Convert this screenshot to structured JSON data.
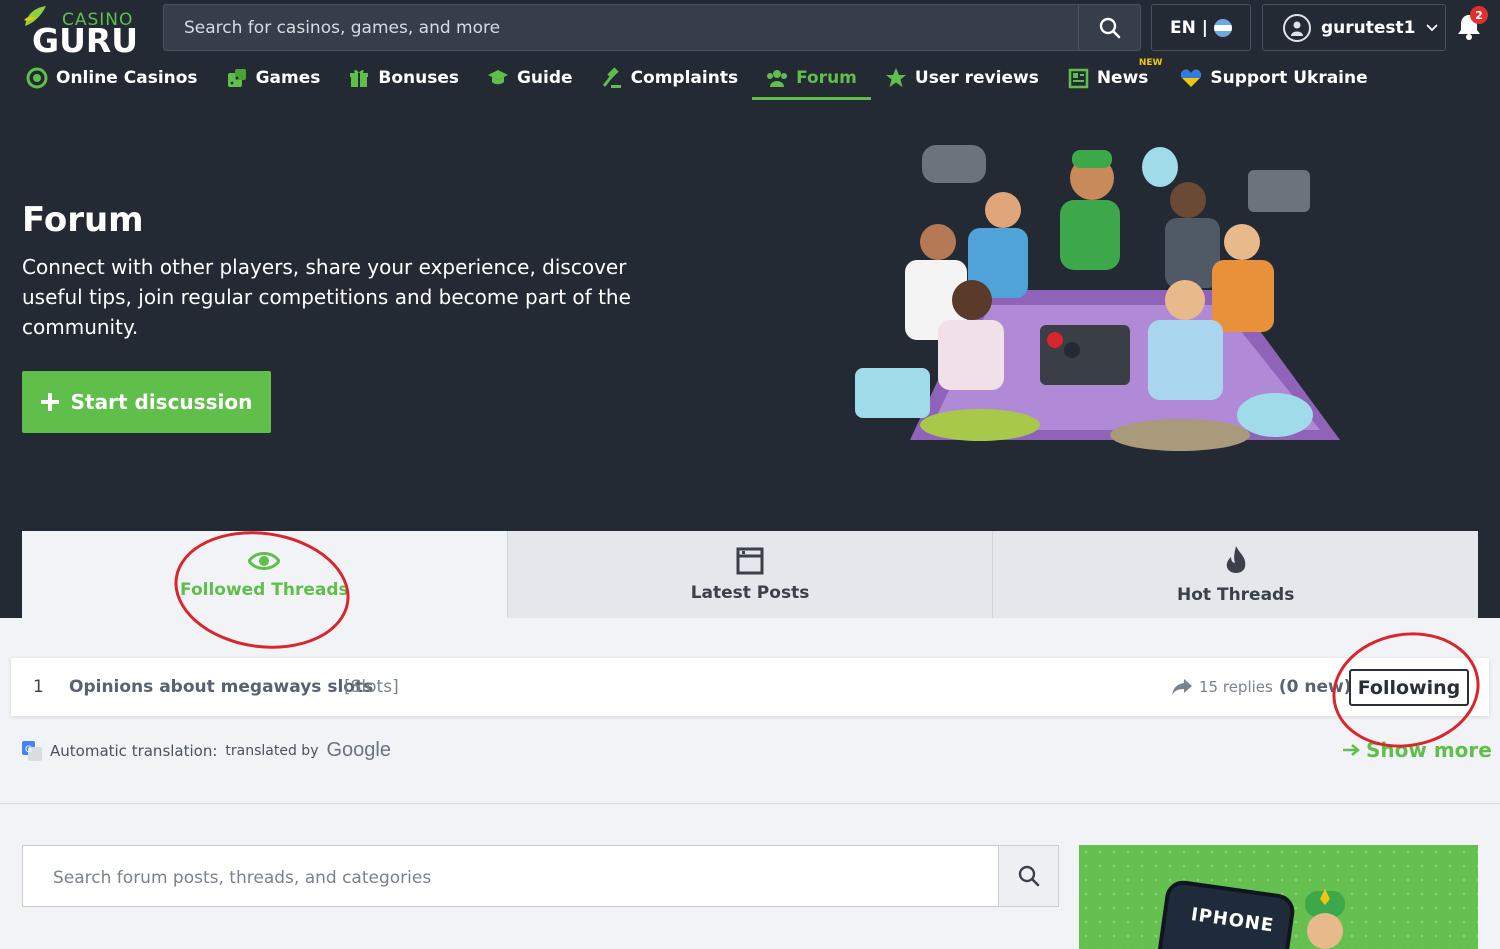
{
  "brand": {
    "line1": "CASINO",
    "line2": "GURU"
  },
  "search": {
    "placeholder": "Search for casinos, games, and more"
  },
  "lang": {
    "label": "EN |"
  },
  "user": {
    "name": "gurutest1"
  },
  "notifications": {
    "count": "2"
  },
  "nav": [
    {
      "label": "Online Casinos",
      "icon": "casino-chip-icon"
    },
    {
      "label": "Games",
      "icon": "dice-icon"
    },
    {
      "label": "Bonuses",
      "icon": "gift-icon"
    },
    {
      "label": "Guide",
      "icon": "graduation-cap-icon"
    },
    {
      "label": "Complaints",
      "icon": "gavel-icon"
    },
    {
      "label": "Forum",
      "icon": "users-icon",
      "active": true
    },
    {
      "label": "User reviews",
      "icon": "star-icon"
    },
    {
      "label": "News",
      "icon": "newspaper-icon",
      "badge": "NEW"
    },
    {
      "label": "Support Ukraine",
      "icon": "heart-icon"
    }
  ],
  "hero": {
    "title": "Forum",
    "description": "Connect with other players, share your experience, discover useful tips, join regular competitions and become part of the community.",
    "cta": "Start discussion"
  },
  "tabs": [
    {
      "label": "Followed Threads",
      "icon": "eye-icon",
      "active": true
    },
    {
      "label": "Latest Posts",
      "icon": "window-icon"
    },
    {
      "label": "Hot Threads",
      "icon": "flame-icon"
    }
  ],
  "threads": [
    {
      "num": "1",
      "title": "Opinions about megaways slots",
      "category": "[Slots]",
      "replies": "15 replies",
      "new": "(0 new)",
      "action": "Following"
    }
  ],
  "translation": {
    "label": "Automatic translation:",
    "by": "translated by",
    "provider": "Google"
  },
  "show_more": "Show more",
  "forum_search": {
    "placeholder": "Search forum posts, threads, and categories"
  },
  "promo": {
    "phone_text": "IPHONE"
  },
  "colors": {
    "accent": "#5fbf4a",
    "dark": "#232a33",
    "annotation": "#d9262c"
  }
}
